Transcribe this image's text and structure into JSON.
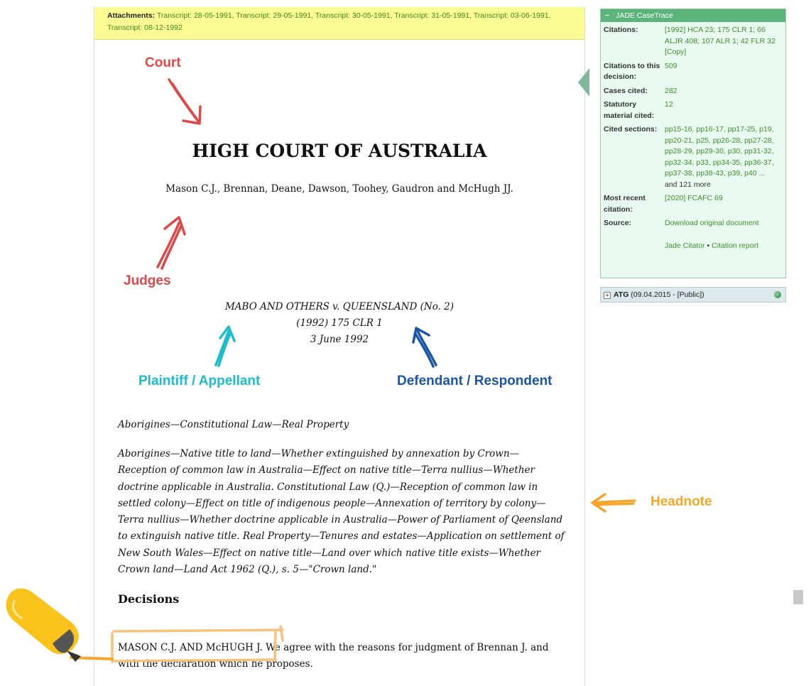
{
  "attachments": {
    "label": "Attachments:",
    "links": "Transcript: 28-05-1991, Transcript: 29-05-1991, Transcript: 30-05-1991, Transcript: 31-05-1991, Transcript: 03-06-1991, Transcript: 08-12-1992"
  },
  "document": {
    "court": "HIGH COURT OF AUSTRALIA",
    "judges": "Mason C.J., Brennan, Deane, Dawson, Toohey, Gaudron and McHugh JJ.",
    "case_name": "MABO AND OTHERS v. QUEENSLAND (No. 2)",
    "citation": "(1992) 175 CLR 1",
    "date": "3 June 1992",
    "headnote_short": "Aborigines—Constitutional Law—Real Property",
    "headnote_long": "Aborigines—Native title to land—Whether extinguished by annexation by Crown—Reception of common law in Australia—Effect on native title—Terra nullius—Whether doctrine applicable in Australia. Constitutional Law (Q.)—Reception of common law in settled colony—Effect on title of indigenous people—Annexation of territory by colony—Terra nullius—Whether doctrine applicable in Australia—Power of Parliament of Qeensland to extinguish native title. Real Property—Tenures and estates—Application on settlement of New South Wales—Effect on native title—Land over which native title exists—Whether Crown land—Land Act 1962 (Q.), s. 5—\"Crown land.\"",
    "decisions_heading": "Decisions",
    "decision_judges": "MASON C.J. AND McHUGH J.",
    "decision_text": " We agree with the reasons for judgment of Brennan J. and with the declaration which he proposes."
  },
  "jade": {
    "title": "JADE CaseTrace",
    "minus": "−",
    "citations_label": "Citations:",
    "citations_value": "[1992] HCA 23; 175 CLR 1; 66 ALJR 408; 107 ALR 1; 42 FLR 32",
    "copy_link": "[Copy]",
    "citations_to_label": "Citations to this decision:",
    "citations_to_value": "509",
    "cases_cited_label": "Cases cited:",
    "cases_cited_value": "282",
    "statutory_label": "Statutory material cited:",
    "statutory_value": "12",
    "cited_sections_label": "Cited sections:",
    "cited_sections_value": "pp15-16, pp16-17, pp17-25, p19, pp20-21, p25, pp26-28, pp27-28, pp28-29, pp29-30, p30, pp31-32, pp32-34, p33, pp34-35, pp36-37, pp37-38, pp38-43, p39, p40 ...",
    "cited_sections_more": "and 121 more",
    "most_recent_label": "Most recent citation:",
    "most_recent_value": "[2020] FCAFC 69",
    "source_label": "Source:",
    "source_value": "Download original document",
    "citator_link": "Jade Citator",
    "separator": "•",
    "report_link": "Citation report"
  },
  "atg": {
    "plus": "+",
    "label": "ATG",
    "detail": " (09.04.2015 - [Public])"
  },
  "annotations": {
    "court": "Court",
    "judges": "Judges",
    "plaintiff": "Plaintiff / Appellant",
    "defendant": "Defendant / Respondent",
    "headnote": "Headnote"
  },
  "colors": {
    "court_annotation": "#e04848",
    "plaintiff_annotation": "#1cbcc8",
    "defendant_annotation": "#1b55a8",
    "headnote_annotation": "#f6a72a",
    "attachments_bg": "#fcfc94",
    "jade_header": "#5bb57a",
    "jade_bg": "#e9fbf1",
    "link_green": "#3f8f2a"
  },
  "icons": [
    "highlighter-icon",
    "globe-icon",
    "expand-plus-icon",
    "collapse-minus-icon"
  ]
}
